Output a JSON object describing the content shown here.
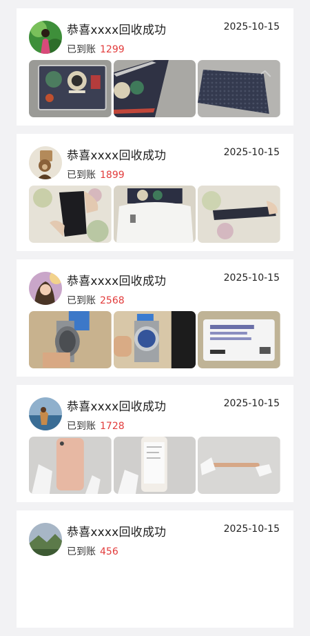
{
  "colors": {
    "page_bg": "#f2f2f4",
    "card_bg": "#ffffff",
    "amount": "#e23b3b"
  },
  "cards": [
    {
      "title": "恭喜xxxx回收成功",
      "date": "2025-10-15",
      "paid_label": "已到账",
      "amount": "1299",
      "avatar_icon": "avatar-green-photo",
      "photos": [
        "wallet-front-photo",
        "wallet-open-photo",
        "wallet-back-photo"
      ]
    },
    {
      "title": "恭喜xxxx回收成功",
      "date": "2025-10-15",
      "paid_label": "已到账",
      "amount": "1899",
      "avatar_icon": "avatar-bear-photo",
      "photos": [
        "wallet-inside-photo",
        "dustbag-photo",
        "wallet-zip-photo"
      ]
    },
    {
      "title": "恭喜xxxx回收成功",
      "date": "2025-10-15",
      "paid_label": "已到账",
      "amount": "2568",
      "avatar_icon": "avatar-girl-photo",
      "photos": [
        "watch-side-photo",
        "watch-face-photo",
        "warranty-card-photo"
      ]
    },
    {
      "title": "恭喜xxxx回收成功",
      "date": "2025-10-15",
      "paid_label": "已到账",
      "amount": "1728",
      "avatar_icon": "avatar-beach-photo",
      "photos": [
        "phone-back-photo",
        "phone-front-photo",
        "phone-edge-photo"
      ]
    },
    {
      "title": "恭喜xxxx回收成功",
      "date": "2025-10-15",
      "paid_label": "已到账",
      "amount": "456",
      "avatar_icon": "avatar-landscape-photo",
      "photos": []
    }
  ]
}
